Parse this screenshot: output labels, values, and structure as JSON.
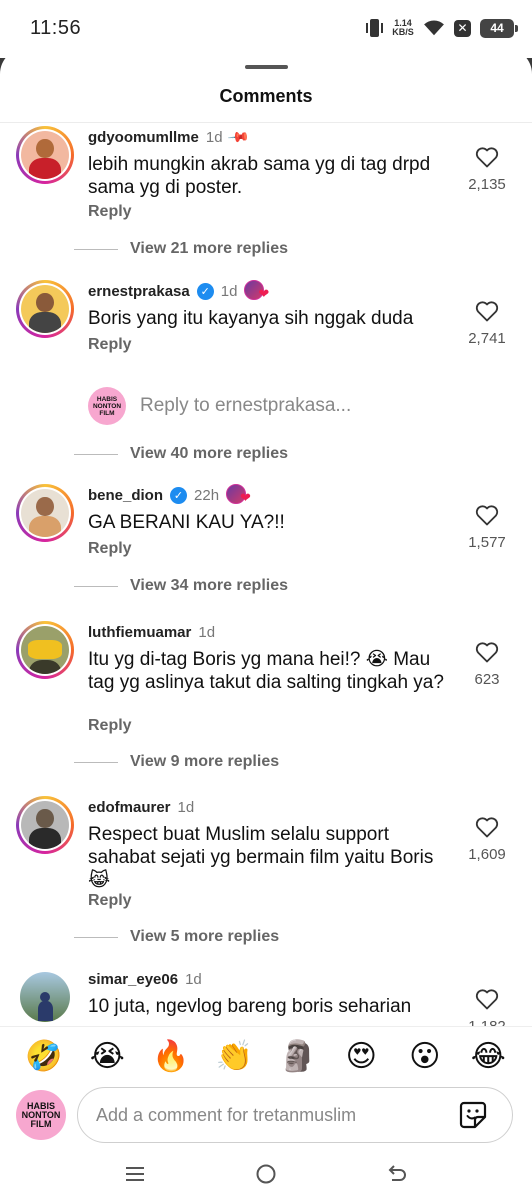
{
  "status_bar": {
    "time": "11:56",
    "net_speed_value": "1.14",
    "net_speed_unit": "KB/S",
    "battery": "44",
    "icons": [
      "vibrate-icon",
      "wifi-icon",
      "x-icon",
      "battery-icon"
    ]
  },
  "sheet": {
    "title": "Comments"
  },
  "comments": [
    {
      "username": "gdyoomumllme",
      "time": "1d",
      "pinned": true,
      "text": "lebih mungkin akrab sama yg di tag drpd sama yg di poster.",
      "reply_label": "Reply",
      "likes": "2,135",
      "view_replies": "View 21 more replies"
    },
    {
      "username": "ernestprakasa",
      "verified": true,
      "time": "1d",
      "text": "Boris yang itu kayanya sih nggak duda",
      "reply_label": "Reply",
      "likes": "2,741",
      "reply_to": "Reply to ernestprakasa...",
      "view_replies": "View 40 more replies"
    },
    {
      "username": "bene_dion",
      "verified": true,
      "time": "22h",
      "text": "GA BERANI KAU YA?!!",
      "reply_label": "Reply",
      "likes": "1,577",
      "view_replies": "View 34 more replies"
    },
    {
      "username": "luthfiemuamar",
      "time": "1d",
      "text": "Itu yg di-tag Boris yg mana hei!? 😭 Mau tag yg aslinya takut dia salting tingkah ya?",
      "reply_label": "Reply",
      "likes": "623",
      "view_replies": "View 9 more replies"
    },
    {
      "username": "edofmaurer",
      "time": "1d",
      "text": "Respect buat Muslim selalu support sahabat sejati yg bermain film yaitu Boris 😹",
      "reply_label": "Reply",
      "likes": "1,609",
      "view_replies": "View 5 more replies"
    },
    {
      "username": "simar_eye06",
      "time": "1d",
      "text": "10 juta, ngevlog bareng boris seharian",
      "likes": "1,182"
    }
  ],
  "reply_avatar_text": "HABIS NONTON FILM",
  "emojis": [
    "🤣",
    "😭",
    "🔥",
    "👏",
    "🗿",
    "😍",
    "😮",
    "😂"
  ],
  "composer": {
    "avatar_text": "HABIS NONTON FILM",
    "placeholder": "Add a comment for tretanmuslim"
  },
  "colors": {
    "ring_gradient": [
      "#f9c33a",
      "#f56a2a",
      "#d6249f",
      "#8a3ab9"
    ],
    "verified": "#1d8cf0",
    "like_heart": "#ee1d52",
    "reply_avatar_bg": "#f7a7cf"
  }
}
